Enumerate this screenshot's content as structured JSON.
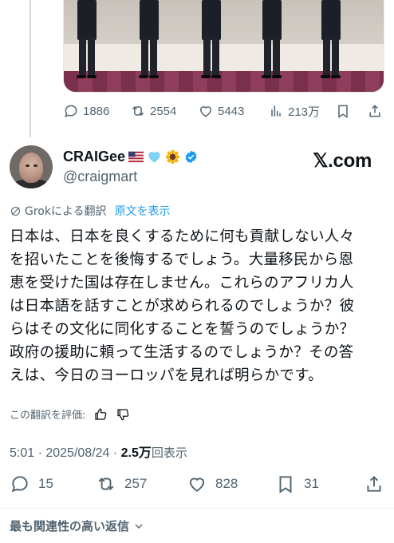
{
  "prev_tweet": {
    "stats": {
      "replies": "1886",
      "reposts": "2554",
      "likes": "5443",
      "views": "213万"
    }
  },
  "tweet": {
    "author": {
      "name": "CRAIGee",
      "handle": "@craigmart",
      "badges": [
        "us-flag-emoji",
        "light-blue-heart-emoji",
        "sunflower-emoji",
        "verified-badge"
      ]
    },
    "source_label": "𝕏.com",
    "translation": {
      "label": "Grokによる翻訳",
      "show_original": "原文を表示",
      "rate_label": "この翻訳を評価:"
    },
    "body_lines": [
      "日本は、日本を良くするために何も貢献しない人々",
      "を招いたことを後悔するでしょう。大量移民から恩",
      "恵を受けた国は存在しません。これらのアフリカ人",
      "は日本語を話すことが求められるのでしょうか？彼",
      "らはその文化に同化することを誓うのでしょうか？",
      "政府の援助に頼って生活するのでしょうか？その答",
      "えは、今日のヨーロッパを見れば明らかです。"
    ],
    "timestamp": "5:01 · 2025/08/24 · ",
    "view_count": "2.5万",
    "view_label": "回表示",
    "stats": {
      "replies": "15",
      "reposts": "257",
      "likes": "828",
      "bookmarks": "31"
    }
  },
  "replies_sort": {
    "label": "最も関連性の高い返信"
  },
  "colors": {
    "text": "#0f1419",
    "muted": "#536471",
    "link": "#1d9bf0",
    "verified": "#1d9bf0"
  }
}
